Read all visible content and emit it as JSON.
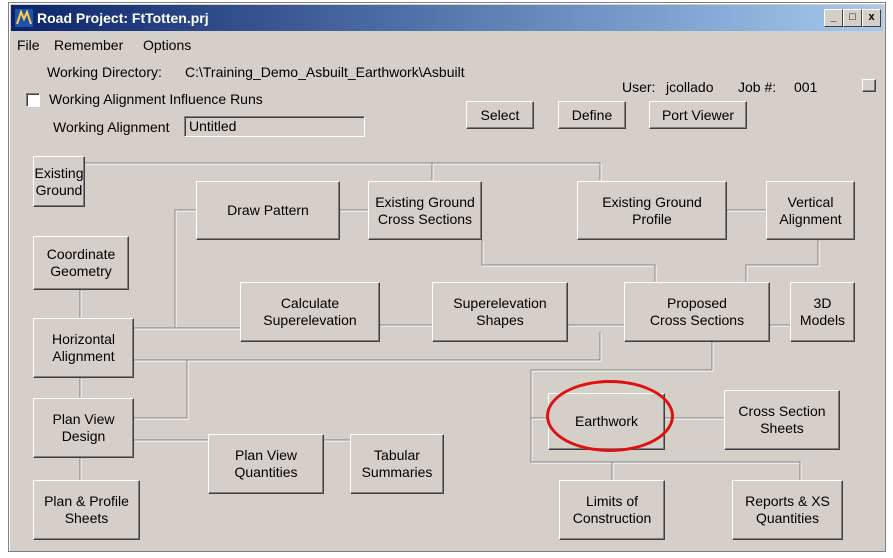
{
  "window": {
    "title": "Road Project: FtTotten.prj",
    "controls": {
      "minimize": "_",
      "maximize": "□",
      "close": "x"
    }
  },
  "menu": {
    "file": "File",
    "remember": "Remember",
    "options": "Options"
  },
  "header": {
    "working_directory_label": "Working Directory:",
    "working_directory_value": "C:\\Training_Demo_Asbuilt_Earthwork\\Asbuilt",
    "user_label": "User:",
    "user_value": "jcollado",
    "job_label": "Job #:",
    "job_value": "001",
    "influence_label": "Working Alignment Influence Runs",
    "alignment_label": "Working Alignment",
    "alignment_value": "Untitled"
  },
  "toolbar": {
    "select": "Select",
    "define": "Define",
    "port_viewer": "Port Viewer"
  },
  "flow": {
    "existing_ground": "Existing\nGround",
    "draw_pattern": "Draw Pattern",
    "eg_cross_sections": "Existing Ground\nCross Sections",
    "eg_profile": "Existing Ground\nProfile",
    "vertical_alignment": "Vertical\nAlignment",
    "coordinate_geometry": "Coordinate\nGeometry",
    "calc_superelevation": "Calculate\nSuperelevation",
    "superelevation_shapes": "Superelevation\nShapes",
    "proposed_cross_sections": "Proposed\nCross Sections",
    "models_3d": "3D\nModels",
    "horizontal_alignment": "Horizontal\nAlignment",
    "plan_view_design": "Plan View\nDesign",
    "plan_view_quantities": "Plan View\nQuantities",
    "tabular_summaries": "Tabular\nSummaries",
    "earthwork": "Earthwork",
    "cross_section_sheets": "Cross Section\nSheets",
    "plan_profile_sheets": "Plan & Profile\nSheets",
    "limits_of_construction": "Limits of\nConstruction",
    "reports_xs_quantities": "Reports & XS\nQuantities"
  },
  "colors": {
    "highlight_circle": "#e01010",
    "title_bar": "#0a246a"
  }
}
